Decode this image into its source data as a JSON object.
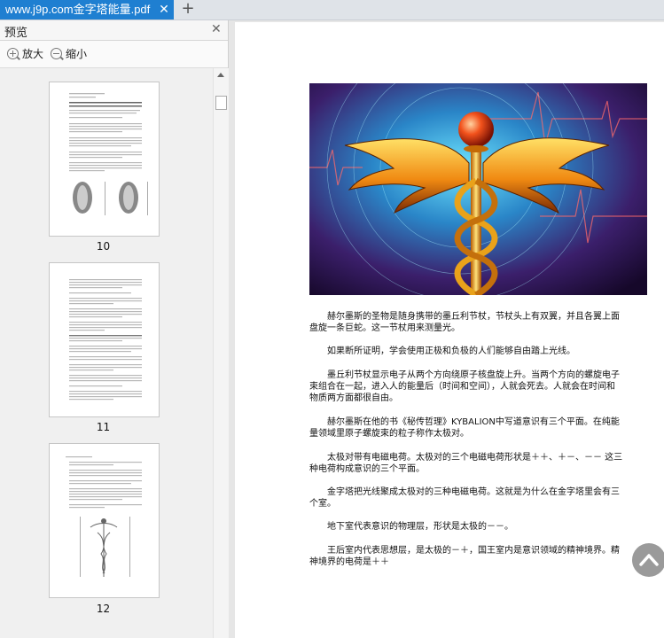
{
  "tab": {
    "title": "www.j9p.com金字塔能量.pdf",
    "close": "✕"
  },
  "new_tab": "+",
  "preview_panel": {
    "title": "预览",
    "close": "✕",
    "zoom_in": "放大",
    "zoom_out": "缩小",
    "thumbnails": [
      {
        "page": "10"
      },
      {
        "page": "11"
      },
      {
        "page": "12"
      }
    ]
  },
  "document": {
    "paragraphs": [
      "赫尔墨斯的圣物是随身携带的墨丘利节杖，节杖头上有双翼，并且各翼上面盘旋一条巨蛇。这一节杖用来测量光。",
      "如果断所证明，学会使用正极和负极的人们能够自由踏上光线。",
      "墨丘利节杖显示电子从两个方向绕原子核盘旋上升。当两个方向的螺旋电子束组合在一起，进入人的能量后（时间和空间），人就会死去。人就会在时间和物质两方面都很自由。",
      [
        "赫尔墨斯在他的书《秘传哲理》",
        "KYBALION",
        "中写道意识有三个平面。在纯能量领域里原子螺旋束的粒子称作太极对。"
      ],
      "太极对带有电磁电荷。太极对的三个电磁电荷形状是＋＋、＋－、－－ 这三种电荷构成意识的三个平面。",
      "金字塔把光线聚成太极对的三种电磁电荷。这就是为什么在金字塔里会有三个室。",
      "地下室代表意识的物理层，形状是太极的－－。",
      "王后室内代表思想层，是太极的－＋，国王室内是意识领域的精神境界。精神境界的电荷是＋＋"
    ]
  },
  "colors": {
    "tab_active": "#1f7fd1",
    "scroll_up_button": "#9a9a9a"
  }
}
